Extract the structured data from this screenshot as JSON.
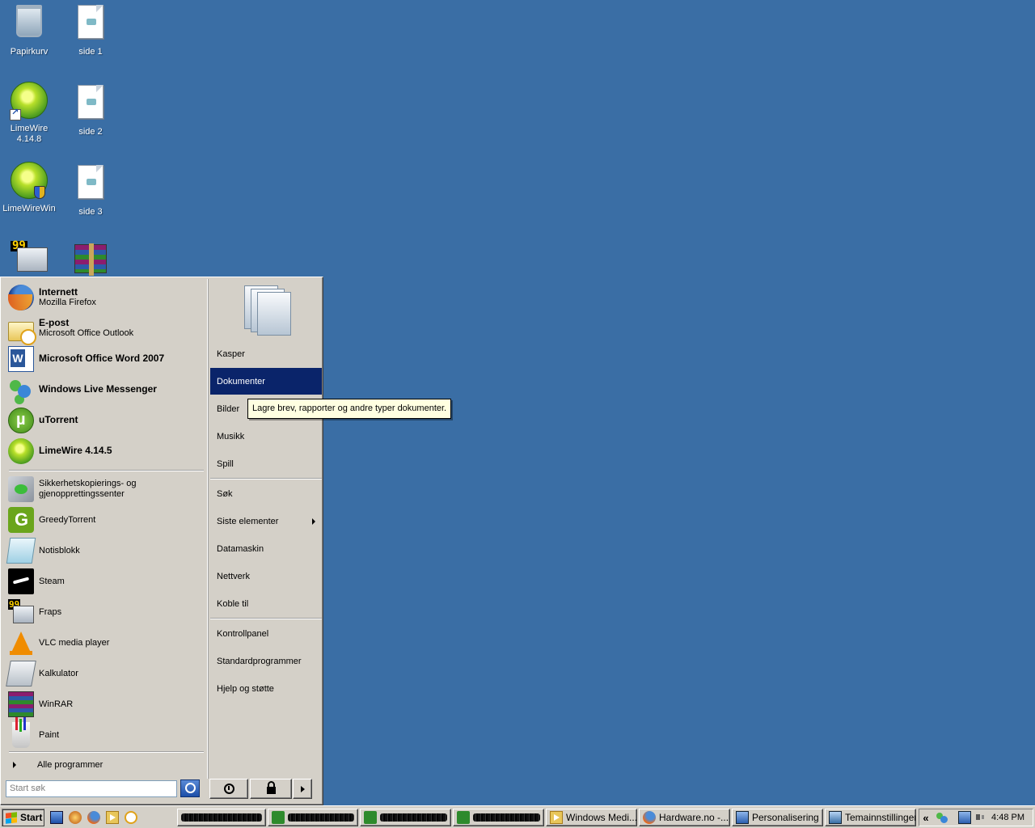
{
  "desktop": {
    "icons": [
      {
        "label": "Papirkurv"
      },
      {
        "label": "side 1"
      },
      {
        "label": "LimeWire 4.14.8"
      },
      {
        "label": "side 2"
      },
      {
        "label": "LimeWireWin"
      },
      {
        "label": "side 3"
      }
    ],
    "fraps_badge": "99"
  },
  "start_menu": {
    "pinned": [
      {
        "title": "Internett",
        "subtitle": "Mozilla Firefox"
      },
      {
        "title": "E-post",
        "subtitle": "Microsoft Office Outlook"
      },
      {
        "title": "Microsoft Office Word 2007"
      },
      {
        "title": "Windows Live Messenger"
      },
      {
        "title": "uTorrent"
      },
      {
        "title": "LimeWire 4.14.5"
      }
    ],
    "recent": [
      {
        "label": "Sikkerhetskopierings- og gjenopprettingssenter"
      },
      {
        "label": "GreedyTorrent"
      },
      {
        "label": "Notisblokk"
      },
      {
        "label": "Steam"
      },
      {
        "label": "Fraps"
      },
      {
        "label": "VLC media player"
      },
      {
        "label": "Kalkulator"
      },
      {
        "label": "WinRAR"
      },
      {
        "label": "Paint"
      }
    ],
    "fraps_badge": "99",
    "all_programs": "Alle programmer",
    "right_items": [
      {
        "label": "Kasper"
      },
      {
        "label": "Dokumenter"
      },
      {
        "label": "Bilder"
      },
      {
        "label": "Musikk"
      },
      {
        "label": "Spill"
      },
      {
        "label": "Søk"
      },
      {
        "label": "Siste elementer"
      },
      {
        "label": "Datamaskin"
      },
      {
        "label": "Nettverk"
      },
      {
        "label": "Koble til"
      },
      {
        "label": "Kontrollpanel"
      },
      {
        "label": "Standardprogrammer"
      },
      {
        "label": "Hjelp og støtte"
      }
    ],
    "selected_item": "Dokumenter",
    "tooltip": "Lagre brev, rapporter og andre typer dokumenter.",
    "search_placeholder": "Start søk"
  },
  "taskbar": {
    "start_label": "Start",
    "tasks": [
      {
        "label": "Windows Medi..."
      },
      {
        "label": "Hardware.no -..."
      },
      {
        "label": "Personalisering"
      },
      {
        "label": "Temainnstillinger"
      }
    ],
    "tray_expand": "«",
    "clock": "4:48 PM"
  },
  "colors": {
    "desktop_bg": "#3a6ea5",
    "menu_bg": "#d4d0c8",
    "selection": "#0a246a",
    "tooltip_bg": "#ffffe1"
  }
}
